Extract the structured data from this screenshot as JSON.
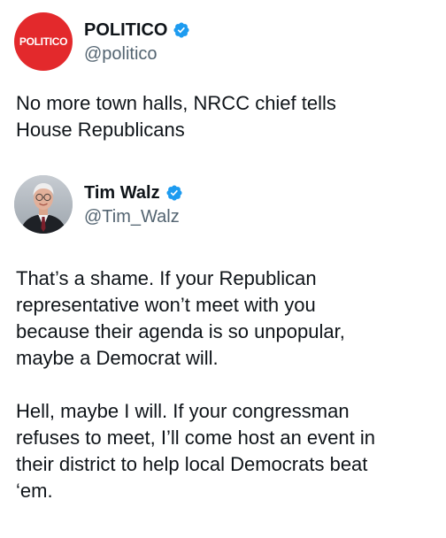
{
  "quoted_post": {
    "author": {
      "display_name": "POLITICO",
      "handle": "@politico",
      "avatar_text": "POLITICO",
      "verified": true,
      "avatar_color": "#e3292c"
    },
    "text": "No more town halls, NRCC chief tells\nHouse Republicans"
  },
  "main_post": {
    "author": {
      "display_name": "Tim Walz",
      "handle": "@Tim_Walz",
      "verified": true
    },
    "paragraphs": [
      "That’s a shame. If your Republican\nrepresentative won’t meet with you\nbecause their agenda is so unpopular,\nmaybe a Democrat will.",
      "Hell, maybe I will. If your congressman\nrefuses to meet, I’ll come host an event in\ntheir district to help local Democrats beat\n‘em."
    ]
  },
  "colors": {
    "verified_badge": "#1d9bf0",
    "text": "#0f1419",
    "secondary_text": "#536471"
  },
  "icons": [
    "verified-badge-icon"
  ]
}
